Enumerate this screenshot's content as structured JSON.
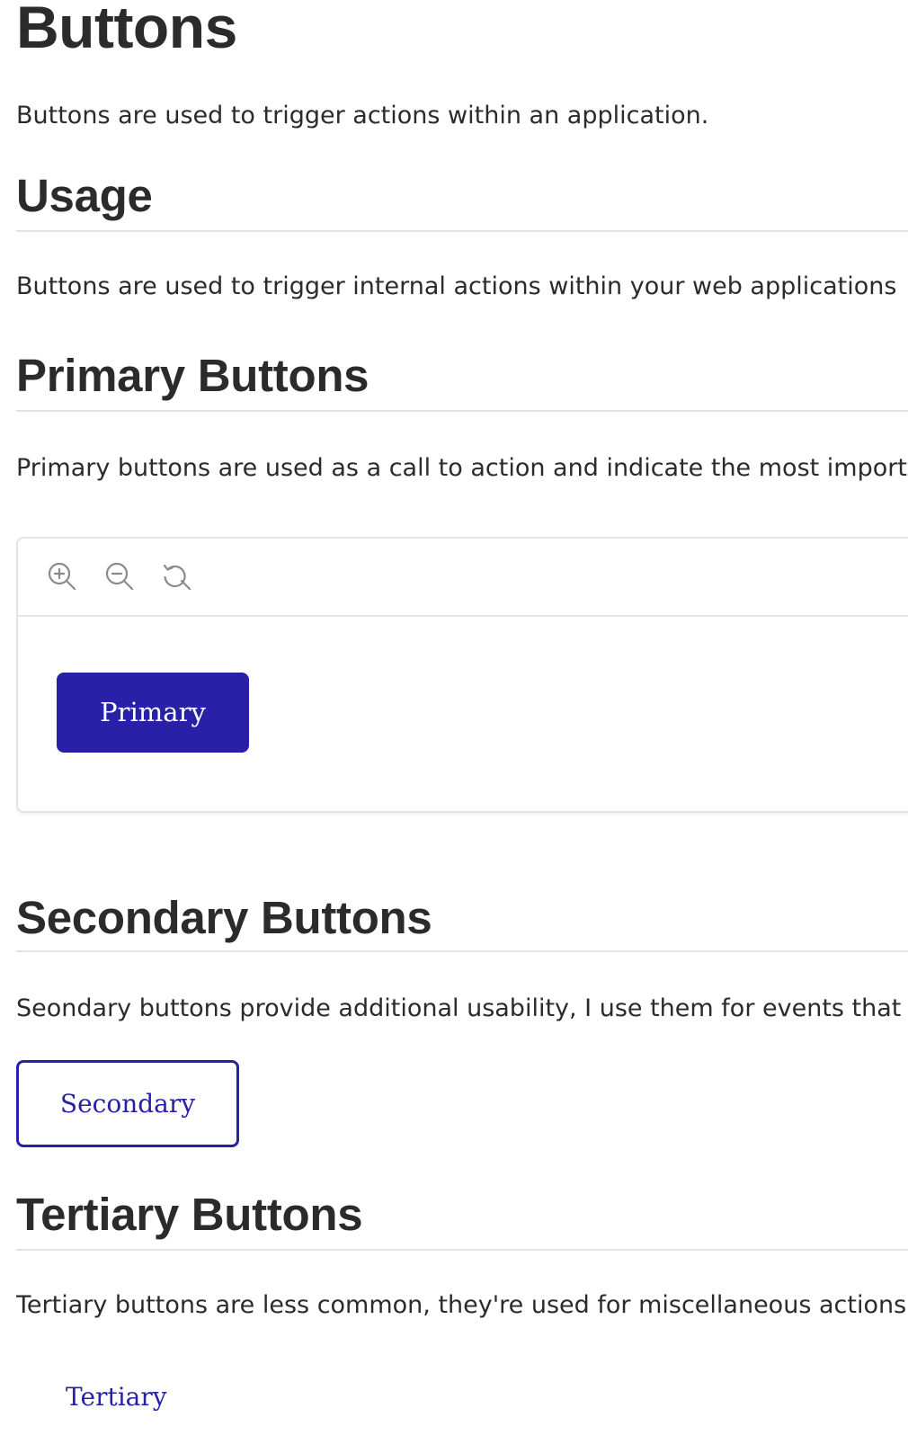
{
  "page": {
    "title": "Buttons",
    "intro": "Buttons are used to trigger actions within an application."
  },
  "usage": {
    "heading": "Usage",
    "text": "Buttons are used to trigger internal actions within your web applications"
  },
  "primary": {
    "heading": "Primary Buttons",
    "text": "Primary buttons are used as a call to action and indicate the most important action",
    "demo": {
      "toolbar": {
        "zoom_in_icon": "zoom-in-icon",
        "zoom_out_icon": "zoom-out-icon",
        "reset_icon": "reset-zoom-icon"
      },
      "button_label": "Primary"
    }
  },
  "secondary": {
    "heading": "Secondary Buttons",
    "text": "Seondary buttons provide additional usability, I use them for events that",
    "button_label": "Secondary"
  },
  "tertiary": {
    "heading": "Tertiary Buttons",
    "text": "Tertiary buttons are less common, they're used for miscellaneous actions",
    "button_label": "Tertiary"
  },
  "colors": {
    "brand": "#2820a7",
    "text": "#2b2b2b",
    "divider": "#e3e3e3",
    "icon": "#8a8a8a"
  }
}
